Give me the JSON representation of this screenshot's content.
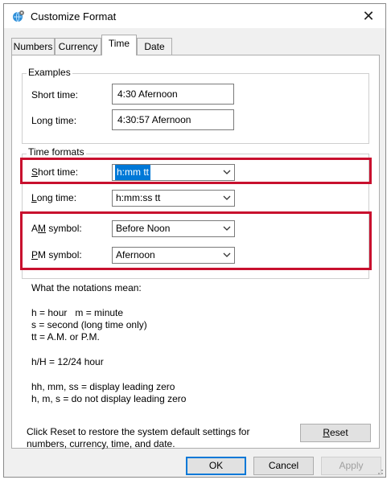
{
  "window": {
    "title": "Customize Format",
    "close_glyph": "✕",
    "icon": "globe-gear-icon"
  },
  "tabs": [
    {
      "label": "Numbers"
    },
    {
      "label": "Currency"
    },
    {
      "label": "Time",
      "active": true
    },
    {
      "label": "Date"
    }
  ],
  "examples": {
    "group_label": "Examples",
    "short_label": "Short time:",
    "short_value": "4:30 Afernoon",
    "long_label": "Long time:",
    "long_value": "4:30:57 Afernoon"
  },
  "time_formats": {
    "group_label": "Time formats",
    "short_label_u": "S",
    "short_label_rest": "hort time:",
    "short_value": "h:mm tt",
    "long_label_u": "L",
    "long_label_rest": "ong time:",
    "long_value": "h:mm:ss tt",
    "am_label_pre": "A",
    "am_label_u": "M",
    "am_label_rest": " symbol:",
    "am_value": "Before Noon",
    "pm_label_u": "P",
    "pm_label_rest": "M symbol:",
    "pm_value": "Afernoon"
  },
  "notations": {
    "heading": "What the notations mean:",
    "line1": "h = hour   m = minute",
    "line2": "s = second (long time only)",
    "line3": "tt = A.M. or P.M.",
    "line4": "h/H = 12/24 hour",
    "line5": "hh, mm, ss = display leading zero",
    "line6": "h, m, s = do not display leading zero"
  },
  "reset": {
    "text_line1": "Click Reset to restore the system default settings for",
    "text_line2": "numbers, currency, time, and date.",
    "button_u": "R",
    "button_rest": "eset"
  },
  "footer": {
    "ok": "OK",
    "cancel": "Cancel",
    "apply": "Apply"
  },
  "colors": {
    "highlight": "#c8102e",
    "selection": "#0078d7"
  }
}
